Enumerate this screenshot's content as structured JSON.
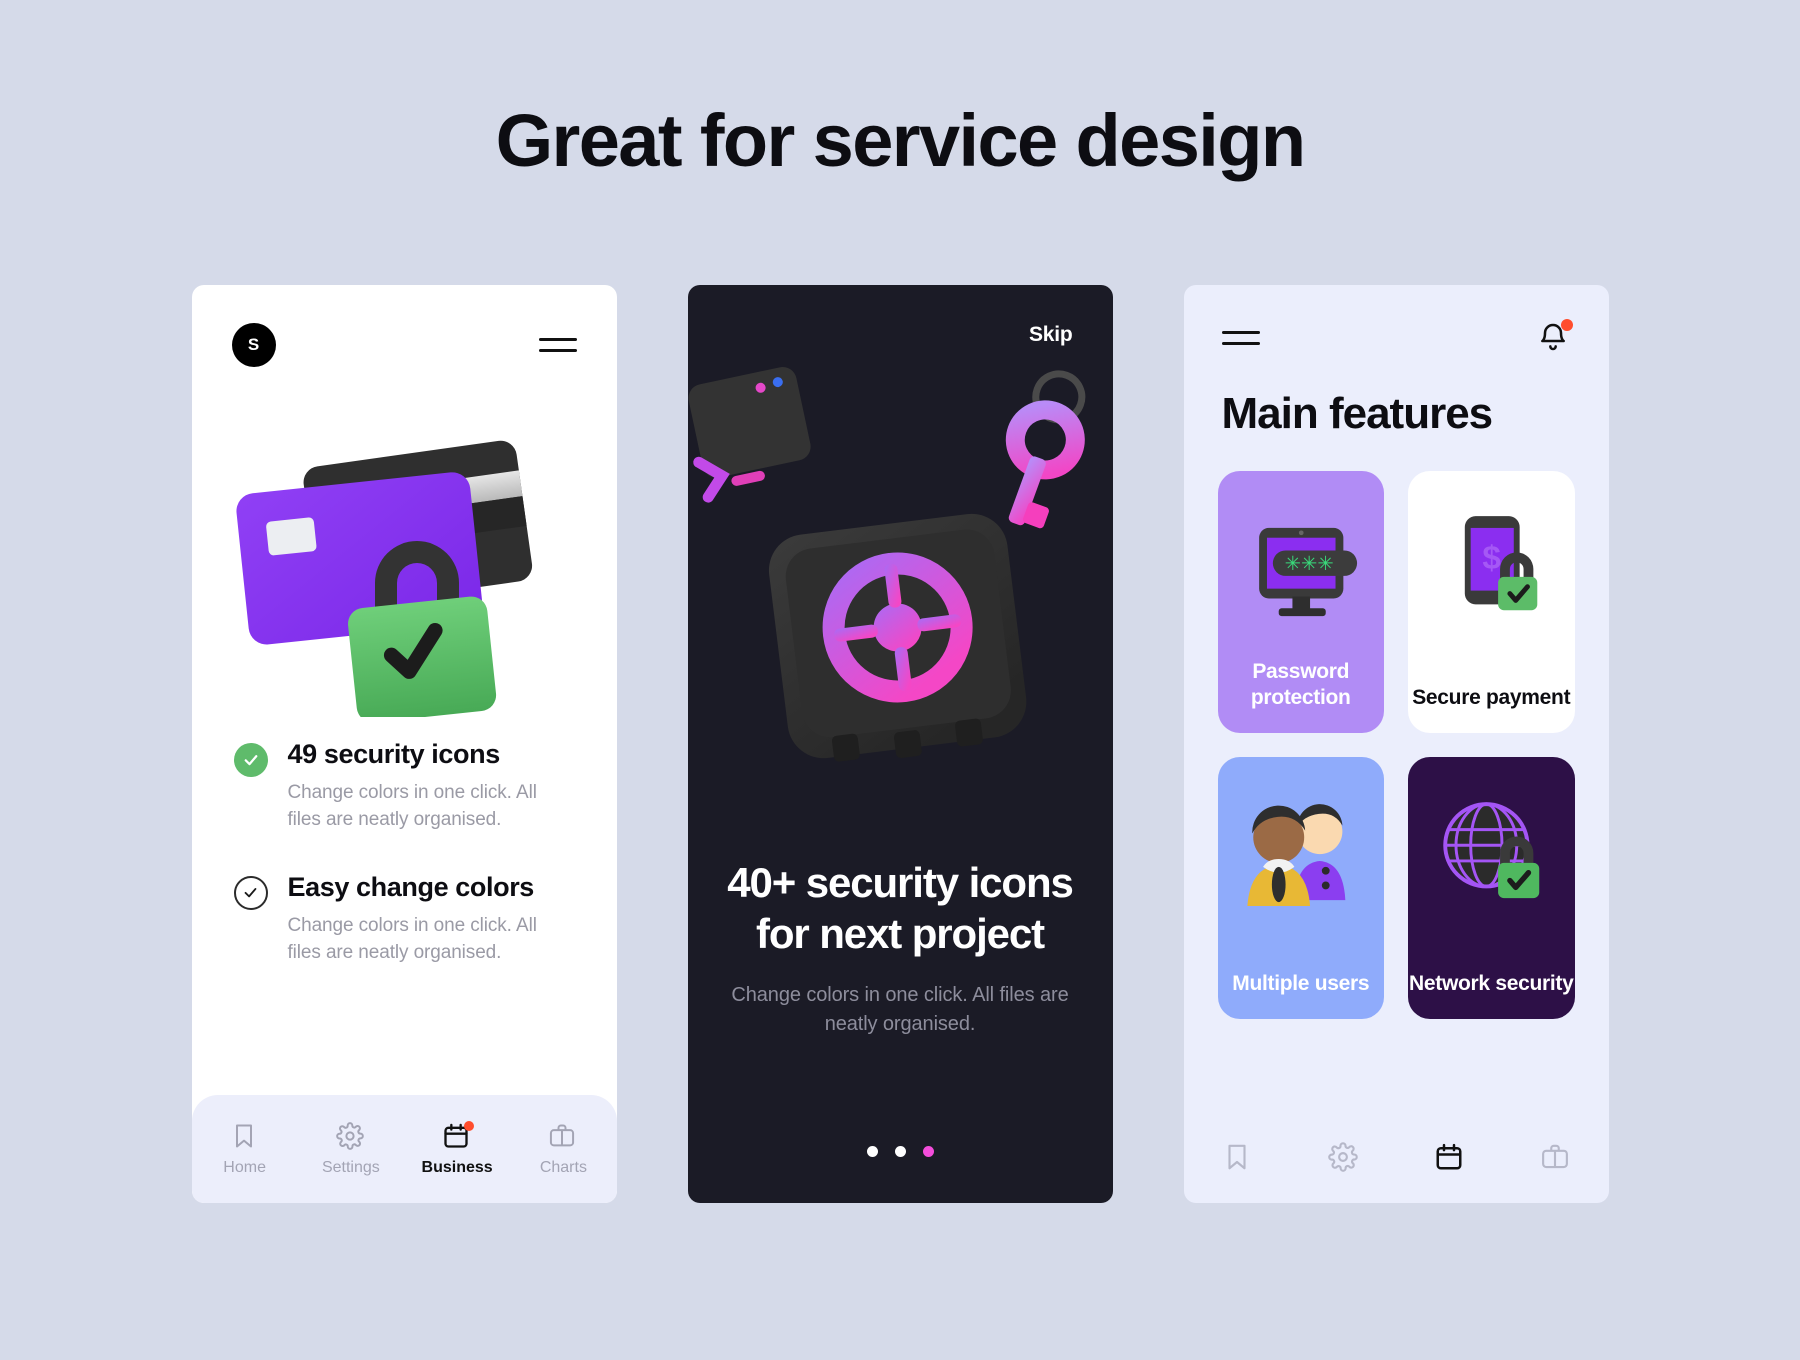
{
  "page": {
    "title": "Great for service design",
    "background_color": "#d5dae9"
  },
  "phone_one": {
    "logo_letter": "S",
    "menu_icon": "hamburger-icon",
    "illustration": "credit-cards-with-green-padlock",
    "features": [
      {
        "title": "49 security icons",
        "description": "Change colors in one click. All files are neatly organised.",
        "check_style": "filled",
        "check_color": "#5fbb6b"
      },
      {
        "title": "Easy change colors",
        "description": "Change colors in one click. All files are neatly organised.",
        "check_style": "outline",
        "check_color": "#1a1a1a"
      }
    ],
    "nav": {
      "background_color": "#eceefb",
      "items": [
        {
          "label": "Home",
          "icon": "bookmark-icon",
          "active": false,
          "badge": false
        },
        {
          "label": "Settings",
          "icon": "gear-icon",
          "active": false,
          "badge": false
        },
        {
          "label": "Business",
          "icon": "calendar-icon",
          "active": true,
          "badge": true
        },
        {
          "label": "Charts",
          "icon": "briefcase-icon",
          "active": false,
          "badge": false
        }
      ],
      "badge_color": "#ff4d2d"
    }
  },
  "phone_two": {
    "background_color": "#1b1b26",
    "skip_label": "Skip",
    "illustration": "dark-safe-with-key-and-window",
    "headline": "40+ security icons for next project",
    "subtitle": "Change colors in one click. All files are neatly organised.",
    "pagination": {
      "total": 3,
      "active_index": 2,
      "active_color": "#f44ddb",
      "inactive_color": "#ffffff"
    }
  },
  "phone_three": {
    "background_color": "#ebeefc",
    "menu_icon": "hamburger-icon",
    "notification_icon": "bell-icon",
    "notification_badge": true,
    "notification_badge_color": "#ff4d2d",
    "title": "Main features",
    "cards": [
      {
        "label": "Password protection",
        "icon": "monitor-password-icon",
        "background_color": "#b18cf5",
        "text_color": "#ffffff"
      },
      {
        "label": "Secure payment",
        "icon": "phone-dollar-lock-icon",
        "background_color": "#ffffff",
        "text_color": "#0d0d12"
      },
      {
        "label": "Multiple users",
        "icon": "two-users-icon",
        "background_color": "#8fabfb",
        "text_color": "#ffffff"
      },
      {
        "label": "Network security",
        "icon": "globe-lock-icon",
        "background_color": "#2d1047",
        "text_color": "#ffffff"
      }
    ],
    "nav": {
      "items": [
        {
          "icon": "bookmark-icon",
          "active": false
        },
        {
          "icon": "gear-icon",
          "active": false
        },
        {
          "icon": "calendar-icon",
          "active": true
        },
        {
          "icon": "briefcase-icon",
          "active": false
        }
      ]
    }
  }
}
